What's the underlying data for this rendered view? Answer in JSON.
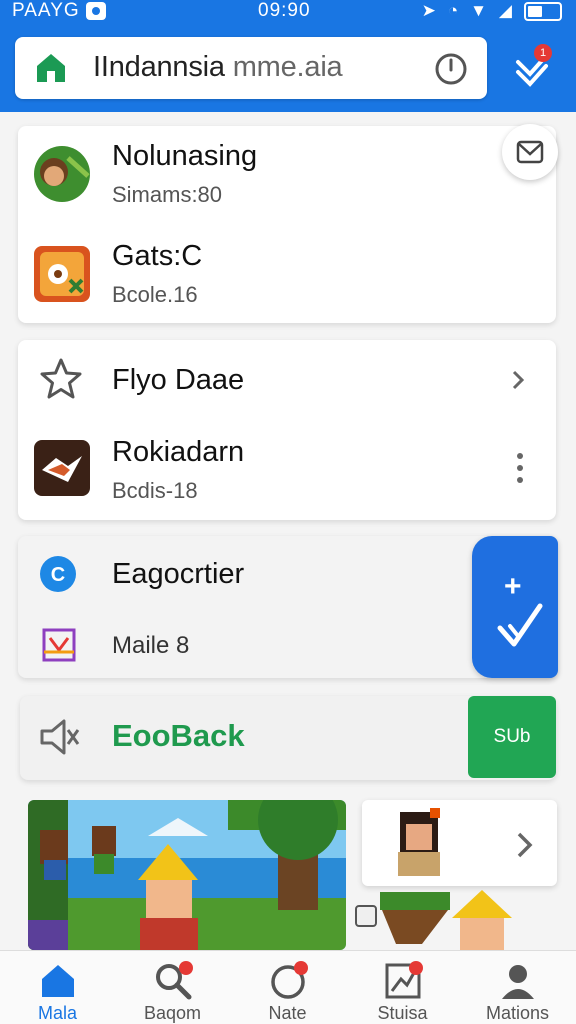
{
  "status": {
    "carrier": "PAAYG",
    "time": "09:90"
  },
  "search": {
    "query_main": "IIndannsia",
    "query_tail": "mme.aia"
  },
  "cards": {
    "top": [
      {
        "title": "Nolunasing",
        "sub": "Simams:80"
      },
      {
        "title": "Gats:C",
        "sub": "Bcole.16"
      }
    ],
    "middle": [
      {
        "title": "Flyo Daae"
      },
      {
        "title": "Rokiadarn",
        "sub": "Bcdis-18"
      }
    ],
    "grey": [
      {
        "title": "Eagocrtier"
      },
      {
        "title": "Maile 8"
      }
    ]
  },
  "feedback": {
    "label": "EooBack",
    "button": "SUb"
  },
  "nav": [
    {
      "label": "Mala"
    },
    {
      "label": "Baqom"
    },
    {
      "label": "Nate"
    },
    {
      "label": "Stuisa"
    },
    {
      "label": "Mations"
    }
  ],
  "colors": {
    "primary": "#1976e3",
    "green": "#21a654",
    "badge": "#e53935"
  }
}
